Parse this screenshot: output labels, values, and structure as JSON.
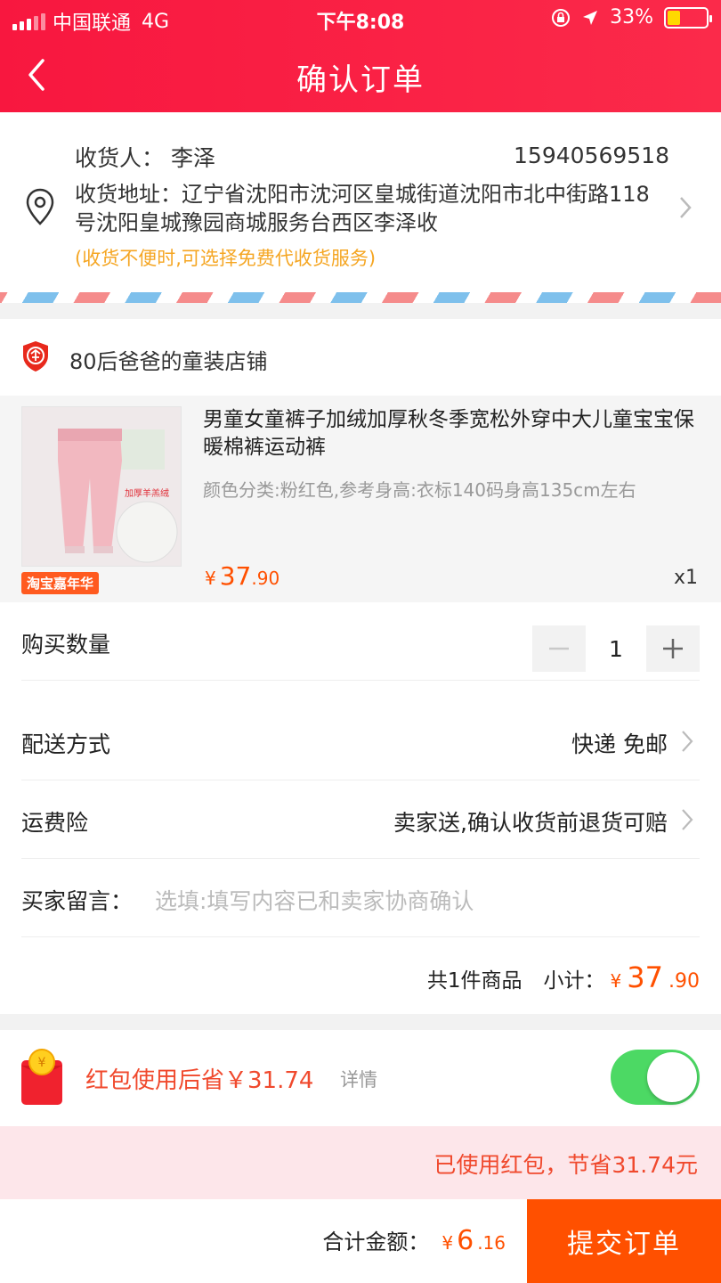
{
  "status_bar": {
    "carrier": "中国联通",
    "network": "4G",
    "time": "下午8:08",
    "battery": "33%"
  },
  "header": {
    "title": "确认订单"
  },
  "address": {
    "recipient_label": "收货人：",
    "recipient": "李泽",
    "phone": "15940569518",
    "address_label": "收货地址：",
    "address": "辽宁省沈阳市沈河区皇城街道沈阳市北中街路118号沈阳皇城豫园商城服务台西区李泽收",
    "note": "(收货不便时,可选择免费代收货服务)"
  },
  "shop": {
    "name": "80后爸爸的童装店铺"
  },
  "item": {
    "title": "男童女童裤子加绒加厚秋冬季宽松外穿中大儿童宝宝保暖棉裤运动裤",
    "spec": "颜色分类:粉红色,参考身高:衣标140码身高135cm左右",
    "badge": "淘宝嘉年华",
    "thumb_caption": "加厚羊羔绒",
    "price_symbol": "¥",
    "price_int": "37",
    "price_dec": ".90",
    "qty": "x1"
  },
  "rows": {
    "quantity_label": "购买数量",
    "quantity_value": "1",
    "delivery_label": "配送方式",
    "delivery_value": "快递 免邮",
    "insurance_label": "运费险",
    "insurance_value": "卖家送,确认收货前退货可赔",
    "message_label": "买家留言：",
    "message_placeholder": "选填:填写内容已和卖家协商确认"
  },
  "subtotal": {
    "count_text": "共1件商品",
    "label": "小计：",
    "symbol": "¥",
    "int": "37",
    "dec": ".90"
  },
  "red_packet": {
    "text": "红包使用后省￥31.74",
    "detail": "详情",
    "enabled": true,
    "saved_text": "已使用红包，节省31.74元"
  },
  "footer": {
    "total_label": "合计金额：",
    "symbol": "¥",
    "int": "6",
    "dec": ".16",
    "submit": "提交订单"
  },
  "colors": {
    "header_red": "#f8173f",
    "accent_orange": "#ff5000",
    "toggle_green": "#4cd964",
    "note_orange": "#f5a623"
  }
}
